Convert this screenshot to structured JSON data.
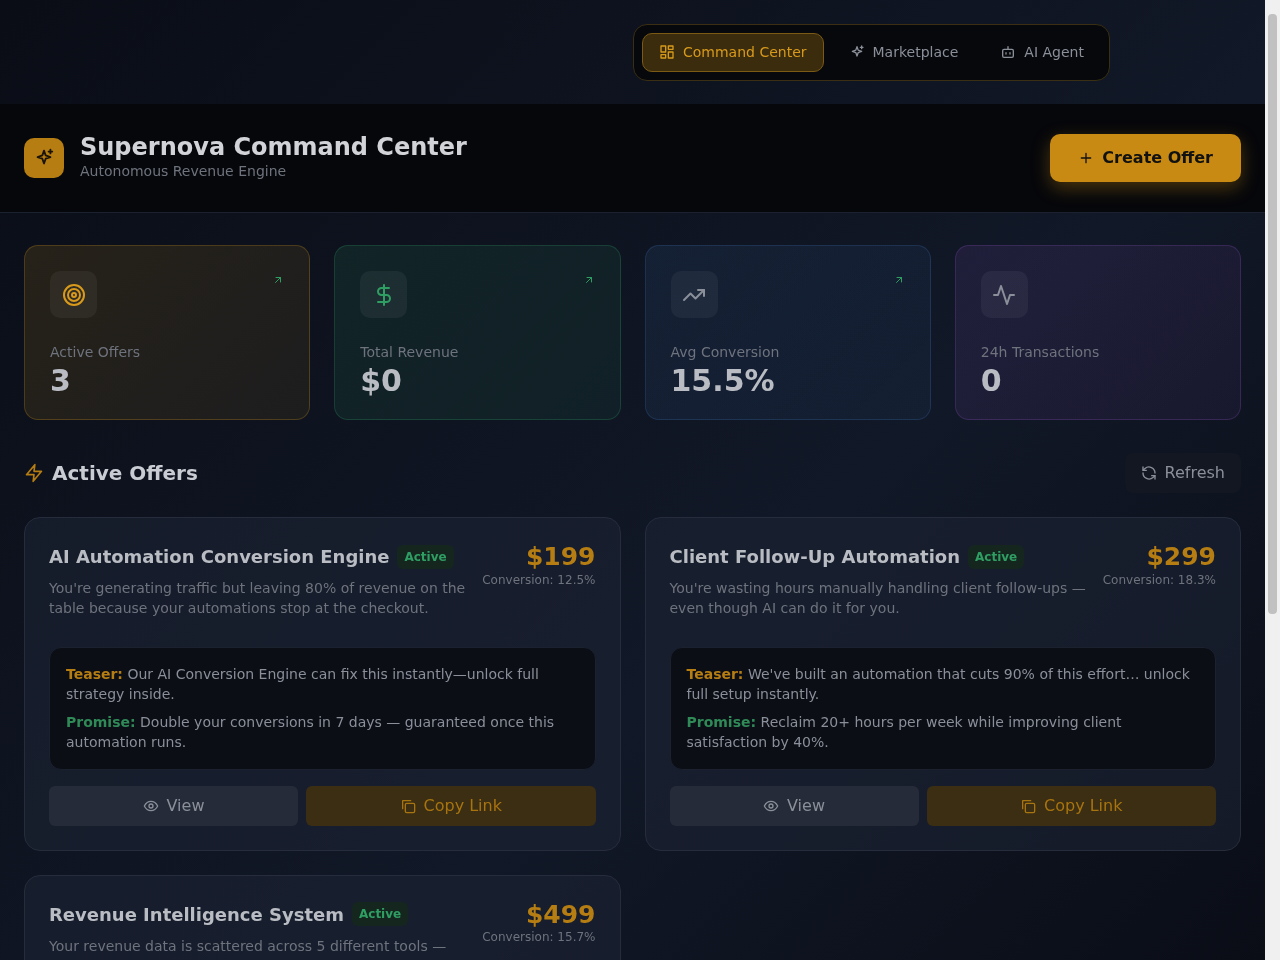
{
  "nav": {
    "tabs": [
      {
        "label": "Command Center",
        "selected": true
      },
      {
        "label": "Marketplace",
        "selected": false
      },
      {
        "label": "AI Agent",
        "selected": false
      }
    ]
  },
  "header": {
    "title": "Supernova Command Center",
    "subtitle": "Autonomous Revenue Engine",
    "create_button": "Create Offer"
  },
  "stats": [
    {
      "label": "Active Offers",
      "value": "3",
      "trend_up": true
    },
    {
      "label": "Total Revenue",
      "value": "$0",
      "trend_up": true
    },
    {
      "label": "Avg Conversion",
      "value": "15.5%",
      "trend_up": true
    },
    {
      "label": "24h Transactions",
      "value": "0",
      "trend_up": false
    }
  ],
  "section": {
    "title": "Active Offers",
    "refresh_button": "Refresh"
  },
  "offers": [
    {
      "title": "AI Automation Conversion Engine",
      "status": "Active",
      "price": "$199",
      "conversion": "Conversion: 12.5%",
      "description": "You're generating traffic but leaving 80% of revenue on the table because your automations stop at the checkout.",
      "teaser_label": "Teaser:",
      "teaser": "Our AI Conversion Engine can fix this instantly—unlock full strategy inside.",
      "promise_label": "Promise:",
      "promise": "Double your conversions in 7 days — guaranteed once this automation runs.",
      "view_button": "View",
      "copy_button": "Copy Link"
    },
    {
      "title": "Client Follow-Up Automation",
      "status": "Active",
      "price": "$299",
      "conversion": "Conversion: 18.3%",
      "description": "You're wasting hours manually handling client follow-ups — even though AI can do it for you.",
      "teaser_label": "Teaser:",
      "teaser": "We've built an automation that cuts 90% of this effort… unlock full setup instantly.",
      "promise_label": "Promise:",
      "promise": "Reclaim 20+ hours per week while improving client satisfaction by 40%.",
      "view_button": "View",
      "copy_button": "Copy Link"
    },
    {
      "title": "Revenue Intelligence System",
      "status": "Active",
      "price": "$499",
      "conversion": "Conversion: 15.7%",
      "description": "Your revenue data is scattered across 5 different tools —"
    }
  ]
}
